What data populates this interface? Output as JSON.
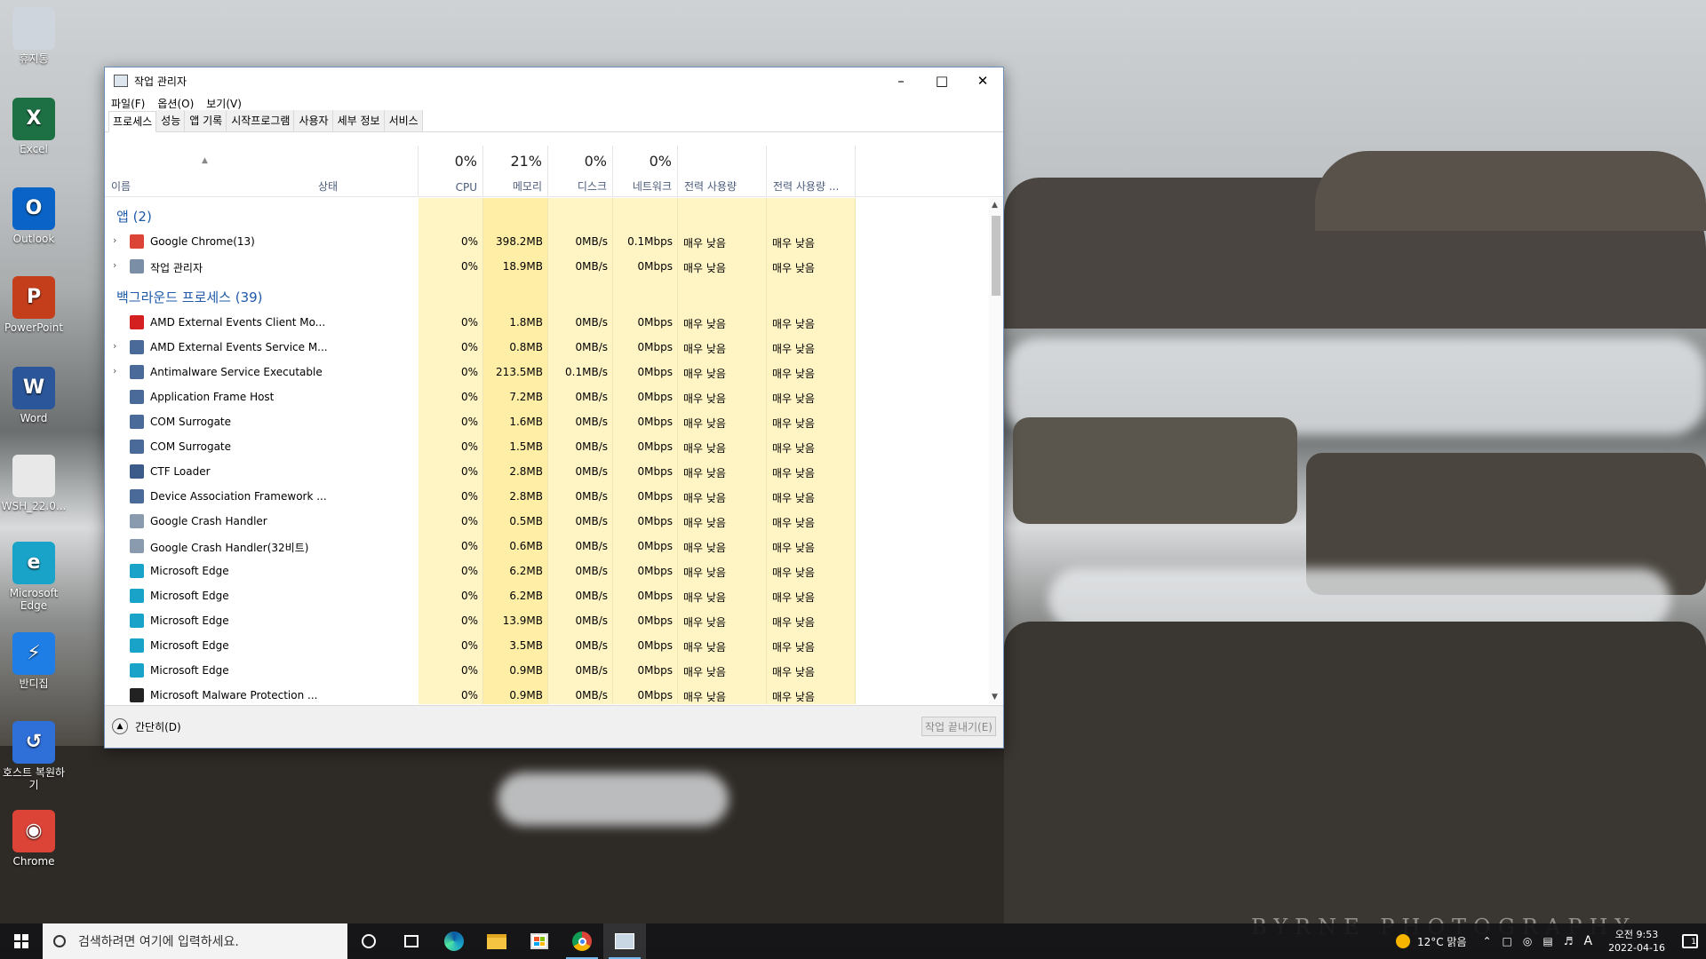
{
  "wallpaper": {
    "credit": "BYRNE  PHOTOGRAPHY"
  },
  "desktop_icons": [
    {
      "label": "휴지통",
      "icon": "recycle-bin-icon",
      "color": "#cfd5dc"
    },
    {
      "label": "Excel",
      "icon": "excel-icon",
      "color": "#1d7044",
      "glyph": "X"
    },
    {
      "label": "Outlook",
      "icon": "outlook-icon",
      "color": "#0a64c8",
      "glyph": "O"
    },
    {
      "label": "PowerPoint",
      "icon": "powerpoint-icon",
      "color": "#c43e1c",
      "glyph": "P"
    },
    {
      "label": "Word",
      "icon": "word-icon",
      "color": "#2b579a",
      "glyph": "W"
    },
    {
      "label": "WSH_22.0...",
      "icon": "file-icon",
      "color": "#e8e8e8",
      "glyph": ""
    },
    {
      "label": "Microsoft Edge",
      "icon": "edge-icon",
      "color": "#1aa3c8",
      "glyph": "e"
    },
    {
      "label": "반디집",
      "icon": "bandizip-icon",
      "color": "#1e7ee6",
      "glyph": "⚡"
    },
    {
      "label": "호스트 복원하기",
      "icon": "restore-host-icon",
      "color": "#2e6fd8",
      "glyph": "↺"
    },
    {
      "label": "Chrome",
      "icon": "chrome-icon",
      "color": "#db4437",
      "glyph": "◉"
    }
  ],
  "window": {
    "title": "작업 관리자",
    "menu": [
      "파일(F)",
      "옵션(O)",
      "보기(V)"
    ],
    "tabs": [
      "프로세스",
      "성능",
      "앱 기록",
      "시작프로그램",
      "사용자",
      "세부 정보",
      "서비스"
    ],
    "active_tab": 0,
    "columns": {
      "name": "이름",
      "status": "상태",
      "cpu": {
        "pct": "0%",
        "label": "CPU"
      },
      "memory": {
        "pct": "21%",
        "label": "메모리"
      },
      "disk": {
        "pct": "0%",
        "label": "디스크"
      },
      "network": {
        "pct": "0%",
        "label": "네트워크"
      },
      "power": "전력 사용량",
      "power_trend": "전력 사용량 ..."
    },
    "groups": [
      {
        "label": "앱 (2)",
        "rows": [
          {
            "name": "Google Chrome(13)",
            "expand": true,
            "icon": "chrome-icon",
            "icolor": "#db4437",
            "cpu": "0%",
            "mem": "398.2MB",
            "disk": "0MB/s",
            "net": "0.1Mbps",
            "power": "매우 낮음",
            "trend": "매우 낮음"
          },
          {
            "name": "작업 관리자",
            "expand": true,
            "icon": "task-manager-icon",
            "icolor": "#7a8ea6",
            "cpu": "0%",
            "mem": "18.9MB",
            "disk": "0MB/s",
            "net": "0Mbps",
            "power": "매우 낮음",
            "trend": "매우 낮음"
          }
        ]
      },
      {
        "label": "백그라운드 프로세스 (39)",
        "rows": [
          {
            "name": "AMD External Events Client Mo...",
            "expand": false,
            "icon": "amd-icon",
            "icolor": "#d42020",
            "cpu": "0%",
            "mem": "1.8MB",
            "disk": "0MB/s",
            "net": "0Mbps",
            "power": "매우 낮음",
            "trend": "매우 낮음"
          },
          {
            "name": "AMD External Events Service M...",
            "expand": true,
            "icon": "service-icon",
            "icolor": "#4a6b9a",
            "cpu": "0%",
            "mem": "0.8MB",
            "disk": "0MB/s",
            "net": "0Mbps",
            "power": "매우 낮음",
            "trend": "매우 낮음"
          },
          {
            "name": "Antimalware Service Executable",
            "expand": true,
            "icon": "service-icon",
            "icolor": "#4a6b9a",
            "cpu": "0%",
            "mem": "213.5MB",
            "disk": "0.1MB/s",
            "net": "0Mbps",
            "power": "매우 낮음",
            "trend": "매우 낮음"
          },
          {
            "name": "Application Frame Host",
            "expand": false,
            "icon": "service-icon",
            "icolor": "#4a6b9a",
            "cpu": "0%",
            "mem": "7.2MB",
            "disk": "0MB/s",
            "net": "0Mbps",
            "power": "매우 낮음",
            "trend": "매우 낮음"
          },
          {
            "name": "COM Surrogate",
            "expand": false,
            "icon": "service-icon",
            "icolor": "#4a6b9a",
            "cpu": "0%",
            "mem": "1.6MB",
            "disk": "0MB/s",
            "net": "0Mbps",
            "power": "매우 낮음",
            "trend": "매우 낮음"
          },
          {
            "name": "COM Surrogate",
            "expand": false,
            "icon": "service-icon",
            "icolor": "#4a6b9a",
            "cpu": "0%",
            "mem": "1.5MB",
            "disk": "0MB/s",
            "net": "0Mbps",
            "power": "매우 낮음",
            "trend": "매우 낮음"
          },
          {
            "name": "CTF Loader",
            "expand": false,
            "icon": "ctf-loader-icon",
            "icolor": "#3c5b8a",
            "cpu": "0%",
            "mem": "2.8MB",
            "disk": "0MB/s",
            "net": "0Mbps",
            "power": "매우 낮음",
            "trend": "매우 낮음"
          },
          {
            "name": "Device Association Framework ...",
            "expand": false,
            "icon": "service-icon",
            "icolor": "#4a6b9a",
            "cpu": "0%",
            "mem": "2.8MB",
            "disk": "0MB/s",
            "net": "0Mbps",
            "power": "매우 낮음",
            "trend": "매우 낮음"
          },
          {
            "name": "Google Crash Handler",
            "expand": false,
            "icon": "google-crash-icon",
            "icolor": "#8a9bb0",
            "cpu": "0%",
            "mem": "0.5MB",
            "disk": "0MB/s",
            "net": "0Mbps",
            "power": "매우 낮음",
            "trend": "매우 낮음"
          },
          {
            "name": "Google Crash Handler(32비트)",
            "expand": false,
            "icon": "google-crash-icon",
            "icolor": "#8a9bb0",
            "cpu": "0%",
            "mem": "0.6MB",
            "disk": "0MB/s",
            "net": "0Mbps",
            "power": "매우 낮음",
            "trend": "매우 낮음"
          },
          {
            "name": "Microsoft Edge",
            "expand": false,
            "icon": "edge-icon",
            "icolor": "#1aa3c8",
            "cpu": "0%",
            "mem": "6.2MB",
            "disk": "0MB/s",
            "net": "0Mbps",
            "power": "매우 낮음",
            "trend": "매우 낮음"
          },
          {
            "name": "Microsoft Edge",
            "expand": false,
            "icon": "edge-icon",
            "icolor": "#1aa3c8",
            "cpu": "0%",
            "mem": "6.2MB",
            "disk": "0MB/s",
            "net": "0Mbps",
            "power": "매우 낮음",
            "trend": "매우 낮음"
          },
          {
            "name": "Microsoft Edge",
            "expand": false,
            "icon": "edge-icon",
            "icolor": "#1aa3c8",
            "cpu": "0%",
            "mem": "13.9MB",
            "disk": "0MB/s",
            "net": "0Mbps",
            "power": "매우 낮음",
            "trend": "매우 낮음"
          },
          {
            "name": "Microsoft Edge",
            "expand": false,
            "icon": "edge-icon",
            "icolor": "#1aa3c8",
            "cpu": "0%",
            "mem": "3.5MB",
            "disk": "0MB/s",
            "net": "0Mbps",
            "power": "매우 낮음",
            "trend": "매우 낮음"
          },
          {
            "name": "Microsoft Edge",
            "expand": false,
            "icon": "edge-icon",
            "icolor": "#1aa3c8",
            "cpu": "0%",
            "mem": "0.9MB",
            "disk": "0MB/s",
            "net": "0Mbps",
            "power": "매우 낮음",
            "trend": "매우 낮음"
          },
          {
            "name": "Microsoft Malware Protection ...",
            "expand": false,
            "icon": "shield-icon",
            "icolor": "#222222",
            "cpu": "0%",
            "mem": "0.9MB",
            "disk": "0MB/s",
            "net": "0Mbps",
            "power": "매우 낮음",
            "trend": "매우 낮음"
          }
        ]
      }
    ],
    "footer": {
      "fewer_details": "간단히(D)",
      "end_task": "작업 끝내기(E)"
    }
  },
  "taskbar": {
    "search_placeholder": "검색하려면 여기에 입력하세요.",
    "pinned": [
      "cortana-icon",
      "task-view-icon",
      "edge-icon",
      "file-explorer-icon",
      "store-icon",
      "chrome-icon",
      "task-manager-icon"
    ],
    "weather": "12°C 맑음",
    "ime": "A",
    "time": "오전 9:53",
    "date": "2022-04-16",
    "notification_count": "1"
  }
}
